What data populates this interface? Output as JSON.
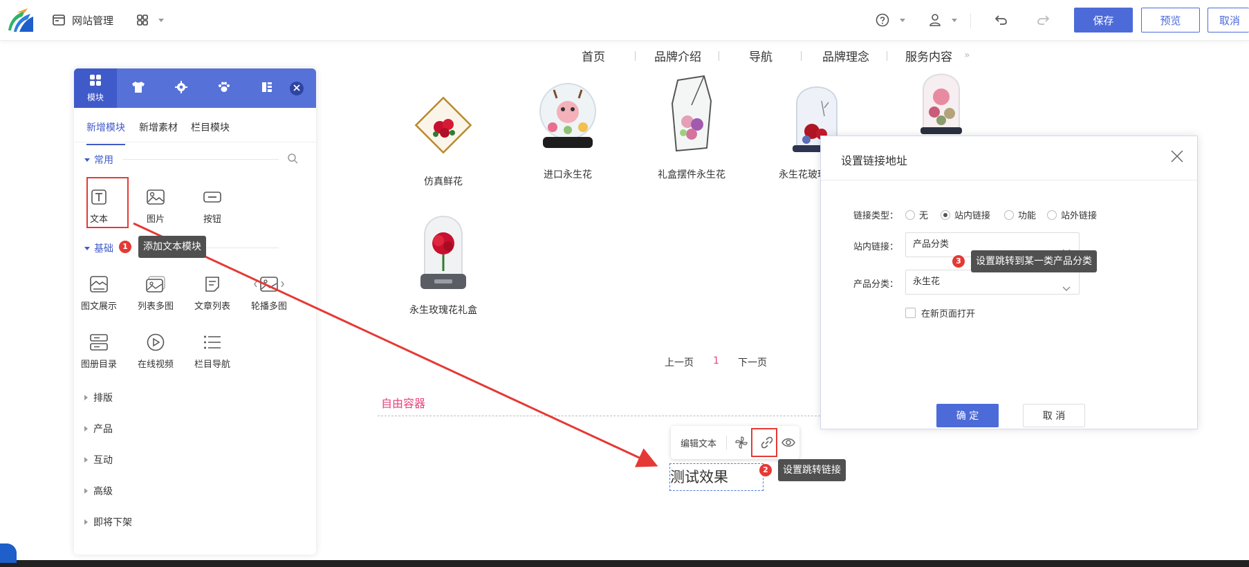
{
  "topbar": {
    "site_manage": "网站管理",
    "save": "保存",
    "preview": "预览",
    "cancel": "取消"
  },
  "nav": [
    "首页",
    "品牌介绍",
    "导航",
    "品牌理念",
    "服务内容"
  ],
  "products": [
    "仿真鲜花",
    "进口永生花",
    "礼盒摆件永生花",
    "永生花玻璃",
    "",
    "永生玫瑰花礼盒"
  ],
  "pager": {
    "prev": "上一页",
    "current": "1",
    "next": "下一页"
  },
  "panel": {
    "tabs": [
      {
        "label": "模块",
        "icon": "grid-icon"
      },
      {
        "label": "",
        "icon": "shirt-icon"
      },
      {
        "label": "",
        "icon": "gear-icon"
      },
      {
        "label": "",
        "icon": "paw-icon"
      },
      {
        "label": "",
        "icon": "list-icon"
      }
    ],
    "subtabs": [
      "新增模块",
      "新增素材",
      "栏目模块"
    ],
    "common_title": "常用",
    "common_items": [
      "文本",
      "图片",
      "按钮"
    ],
    "basic_title": "基础",
    "basic_items": [
      "图文展示",
      "列表多图",
      "文章列表",
      "轮播多图",
      "图册目录",
      "在线视频",
      "栏目导航"
    ],
    "categories": [
      "排版",
      "产品",
      "互动",
      "高级",
      "即将下架"
    ]
  },
  "free_container": "自由容器",
  "float_toolbar": {
    "edit_text": "编辑文本"
  },
  "test_text": "测试效果",
  "tips": {
    "add_text": "添加文本模块",
    "set_link": "设置跳转链接",
    "set_category": "设置跳转到某一类产品分类"
  },
  "badges": [
    "1",
    "2",
    "3"
  ],
  "dialog": {
    "title": "设置链接地址",
    "link_type_label": "链接类型：",
    "link_types": [
      "无",
      "站内链接",
      "功能",
      "站外链接"
    ],
    "selected_link_type": "站内链接",
    "internal_label": "站内链接：",
    "internal_value": "产品分类",
    "category_label": "产品分类：",
    "category_value": "永生花",
    "new_window": "在新页面打开",
    "ok": "确 定",
    "cancel": "取 消"
  },
  "colors": {
    "primary": "#4d6bd8",
    "highlight": "#e53935",
    "free_label": "#e8447b"
  }
}
